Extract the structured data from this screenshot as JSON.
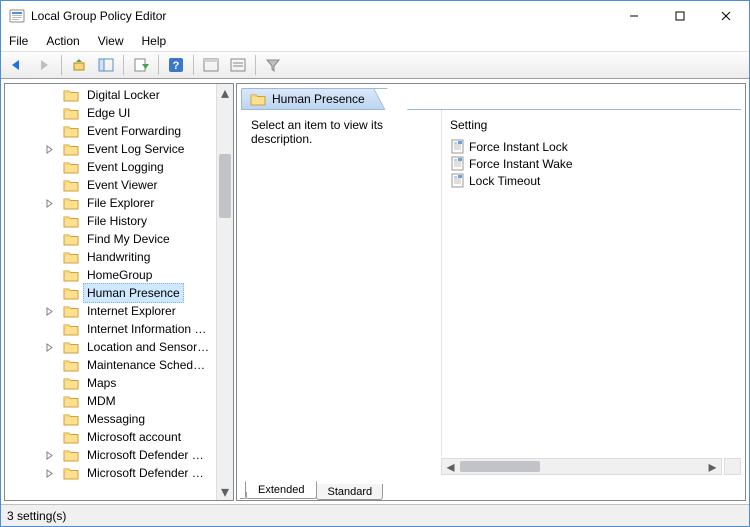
{
  "window": {
    "title": "Local Group Policy Editor"
  },
  "menu": {
    "file": "File",
    "action": "Action",
    "view": "View",
    "help": "Help"
  },
  "tree": {
    "items": [
      {
        "label": "Digital Locker",
        "expander": ""
      },
      {
        "label": "Edge UI",
        "expander": ""
      },
      {
        "label": "Event Forwarding",
        "expander": ""
      },
      {
        "label": "Event Log Service",
        "expander": ">"
      },
      {
        "label": "Event Logging",
        "expander": ""
      },
      {
        "label": "Event Viewer",
        "expander": ""
      },
      {
        "label": "File Explorer",
        "expander": ">"
      },
      {
        "label": "File History",
        "expander": ""
      },
      {
        "label": "Find My Device",
        "expander": ""
      },
      {
        "label": "Handwriting",
        "expander": ""
      },
      {
        "label": "HomeGroup",
        "expander": ""
      },
      {
        "label": "Human Presence",
        "expander": "",
        "selected": true
      },
      {
        "label": "Internet Explorer",
        "expander": ">"
      },
      {
        "label": "Internet Information …",
        "expander": ""
      },
      {
        "label": "Location and Sensor…",
        "expander": ">"
      },
      {
        "label": "Maintenance Sched…",
        "expander": ""
      },
      {
        "label": "Maps",
        "expander": ""
      },
      {
        "label": "MDM",
        "expander": ""
      },
      {
        "label": "Messaging",
        "expander": ""
      },
      {
        "label": "Microsoft account",
        "expander": ""
      },
      {
        "label": "Microsoft Defender …",
        "expander": ">"
      },
      {
        "label": "Microsoft Defender …",
        "expander": ">"
      }
    ]
  },
  "details": {
    "heading": "Human Presence",
    "description": "Select an item to view its description.",
    "column_header": "Setting",
    "settings": [
      {
        "label": "Force Instant Lock"
      },
      {
        "label": "Force Instant Wake"
      },
      {
        "label": "Lock Timeout"
      }
    ]
  },
  "tabs": {
    "extended": "Extended",
    "standard": "Standard"
  },
  "status": {
    "text": "3 setting(s)"
  }
}
